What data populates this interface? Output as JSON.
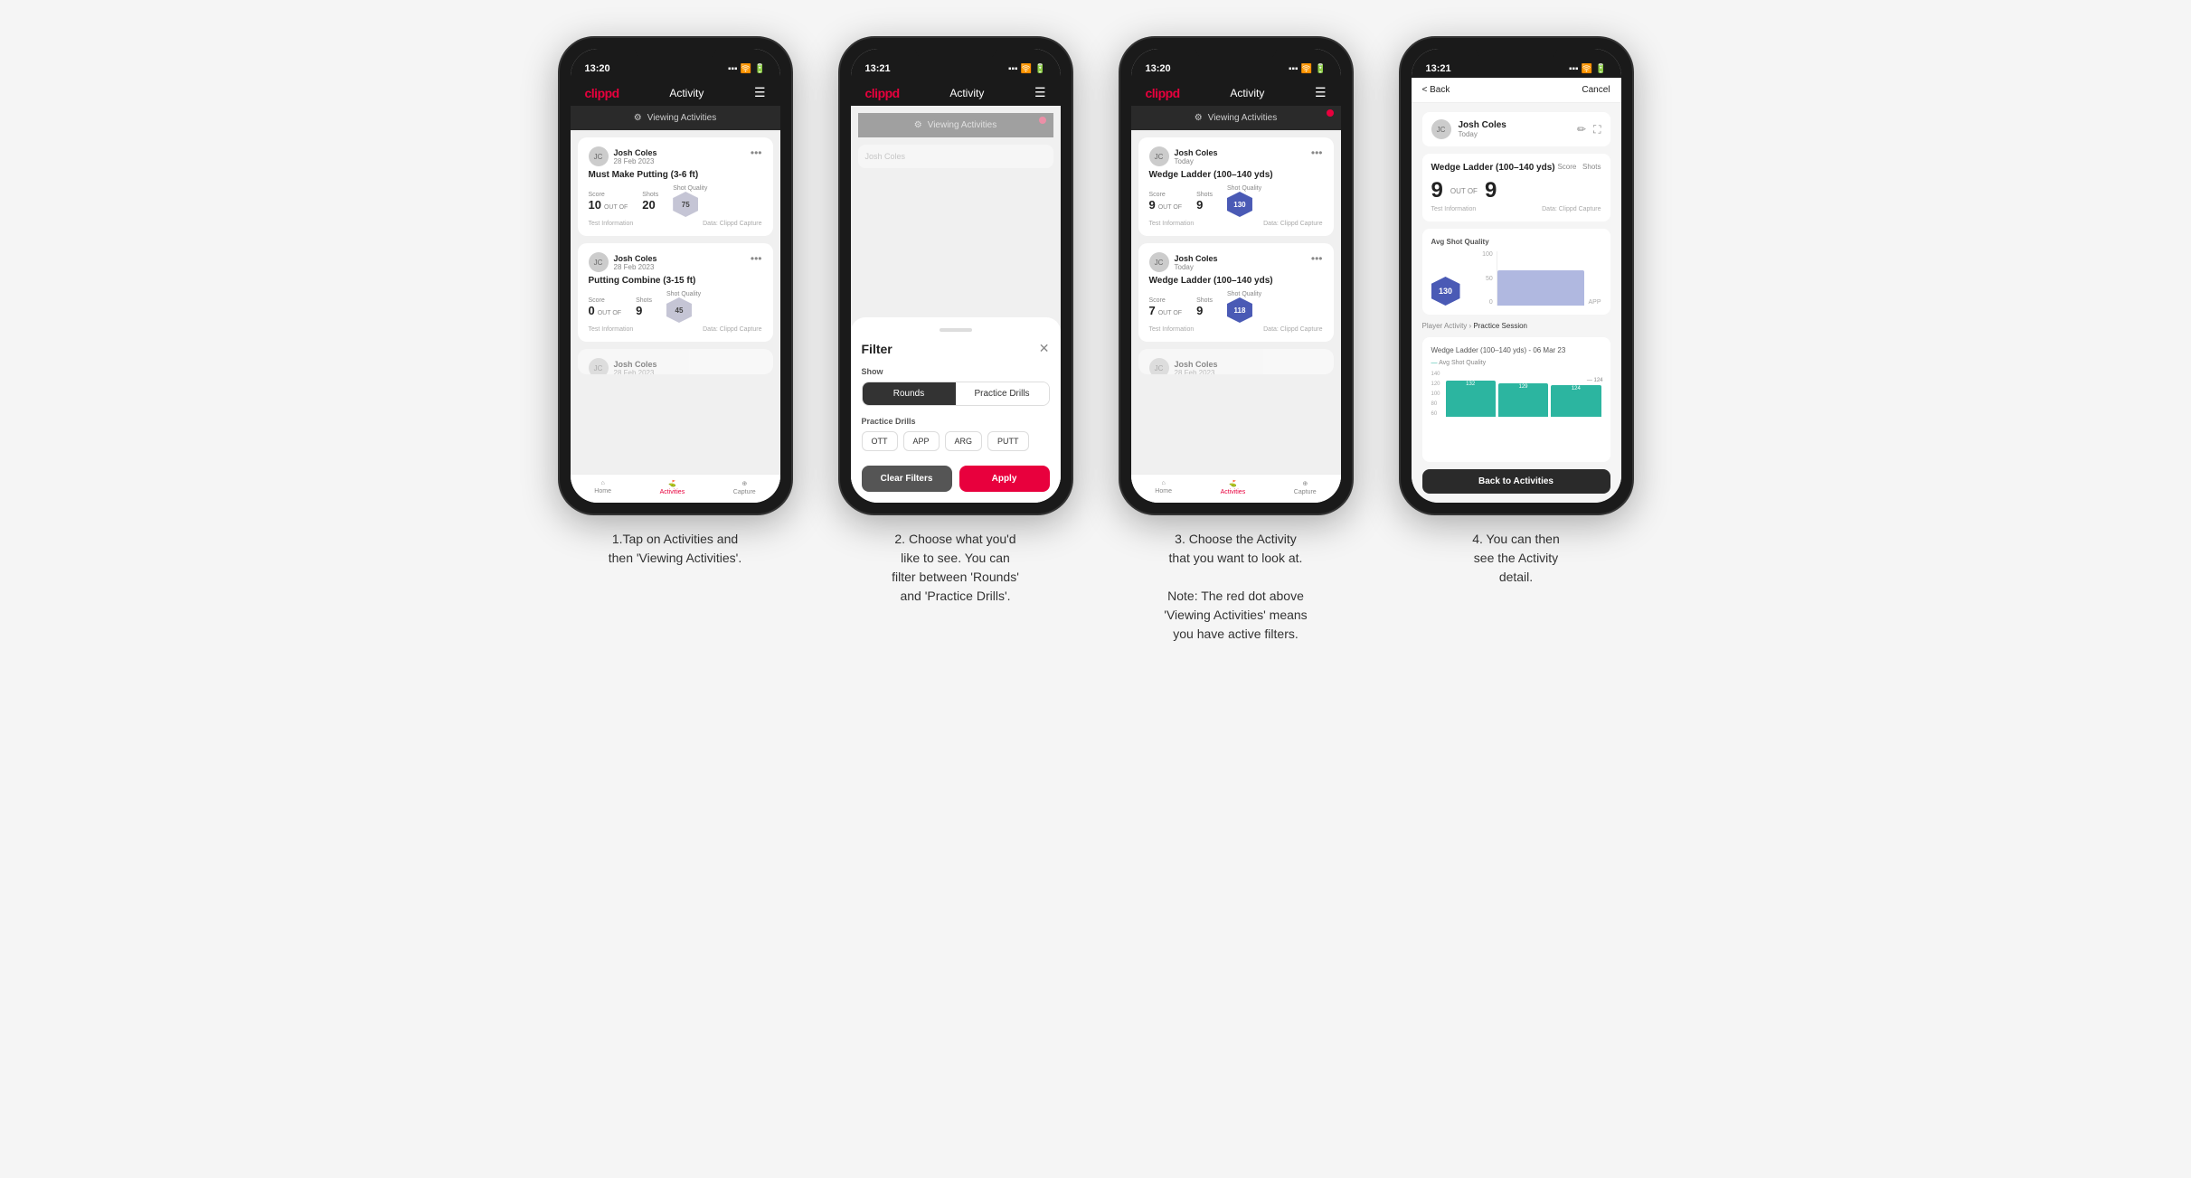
{
  "screens": [
    {
      "id": "screen1",
      "status_time": "13:20",
      "nav_logo": "clippd",
      "nav_title": "Activity",
      "viewing_activities": "Viewing Activities",
      "has_red_dot": false,
      "cards": [
        {
          "user_name": "Josh Coles",
          "user_date": "28 Feb 2023",
          "title": "Must Make Putting (3-6 ft)",
          "score_label": "Score",
          "shots_label": "Shots",
          "quality_label": "Shot Quality",
          "score": "10",
          "outof": "OUT OF",
          "shots": "20",
          "quality": "75",
          "info": "Test Information",
          "data": "Data: Clippd Capture"
        },
        {
          "user_name": "Josh Coles",
          "user_date": "28 Feb 2023",
          "title": "Putting Combine (3-15 ft)",
          "score_label": "Score",
          "shots_label": "Shots",
          "quality_label": "Shot Quality",
          "score": "0",
          "outof": "OUT OF",
          "shots": "9",
          "quality": "45",
          "info": "Test Information",
          "data": "Data: Clippd Capture"
        },
        {
          "user_name": "Josh Coles",
          "user_date": "28 Feb 2023",
          "title": "",
          "score": "",
          "shots": "",
          "quality": "",
          "partial": true
        }
      ]
    },
    {
      "id": "screen2",
      "status_time": "13:21",
      "nav_logo": "clippd",
      "nav_title": "Activity",
      "viewing_activities": "Viewing Activities",
      "has_red_dot": true,
      "filter": {
        "title": "Filter",
        "show_label": "Show",
        "rounds_label": "Rounds",
        "drills_label": "Practice Drills",
        "practice_drills_label": "Practice Drills",
        "drill_options": [
          "OTT",
          "APP",
          "ARG",
          "PUTT"
        ],
        "clear_label": "Clear Filters",
        "apply_label": "Apply"
      }
    },
    {
      "id": "screen3",
      "status_time": "13:20",
      "nav_logo": "clippd",
      "nav_title": "Activity",
      "viewing_activities": "Viewing Activities",
      "has_red_dot": true,
      "cards": [
        {
          "user_name": "Josh Coles",
          "user_date": "Today",
          "title": "Wedge Ladder (100–140 yds)",
          "score_label": "Score",
          "shots_label": "Shots",
          "quality_label": "Shot Quality",
          "score": "9",
          "outof": "OUT OF",
          "shots": "9",
          "quality": "130",
          "quality_color": "blue",
          "info": "Test Information",
          "data": "Data: Clippd Capture"
        },
        {
          "user_name": "Josh Coles",
          "user_date": "Today",
          "title": "Wedge Ladder (100–140 yds)",
          "score_label": "Score",
          "shots_label": "Shots",
          "quality_label": "Shot Quality",
          "score": "7",
          "outof": "OUT OF",
          "shots": "9",
          "quality": "118",
          "quality_color": "blue",
          "info": "Test Information",
          "data": "Data: Clippd Capture"
        },
        {
          "user_name": "Josh Coles",
          "user_date": "28 Feb 2023",
          "title": "",
          "partial": true
        }
      ]
    },
    {
      "id": "screen4",
      "status_time": "13:21",
      "back_label": "< Back",
      "cancel_label": "Cancel",
      "user_name": "Josh Coles",
      "user_date": "Today",
      "drill_title": "Wedge Ladder (100–140 yds)",
      "score_section": {
        "score_label": "Score",
        "shots_label": "Shots",
        "score": "9",
        "outof": "OUT OF",
        "shots": "9",
        "info": "Test Information",
        "data": "Data: Clippd Capture"
      },
      "avg_quality_label": "Avg Shot Quality",
      "quality_value": "130",
      "chart_label": "130",
      "chart_y_labels": [
        "100",
        "50",
        "0"
      ],
      "chart_app_label": "APP",
      "player_activity_label": "Player Activity",
      "practice_session_label": "Practice Session",
      "detail_section_title": "Wedge Ladder (100–140 yds) - 06 Mar 23",
      "detail_chart_label": "Avg Shot Quality",
      "bar_values": [
        132,
        129,
        124
      ],
      "bar_labels": [
        "",
        "",
        ""
      ],
      "y_axis_vals": [
        "140",
        "120",
        "100",
        "80",
        "60"
      ],
      "back_to_activities": "Back to Activities"
    }
  ],
  "captions": [
    "1.Tap on Activities and\nthen 'Viewing Activities'.",
    "2. Choose what you'd\nlike to see. You can\nfilter between 'Rounds'\nand 'Practice Drills'.",
    "3. Choose the Activity\nthat you want to look at.\n\nNote: The red dot above\n'Viewing Activities' means\nyou have active filters.",
    "4. You can then\nsee the Activity\ndetail."
  ]
}
